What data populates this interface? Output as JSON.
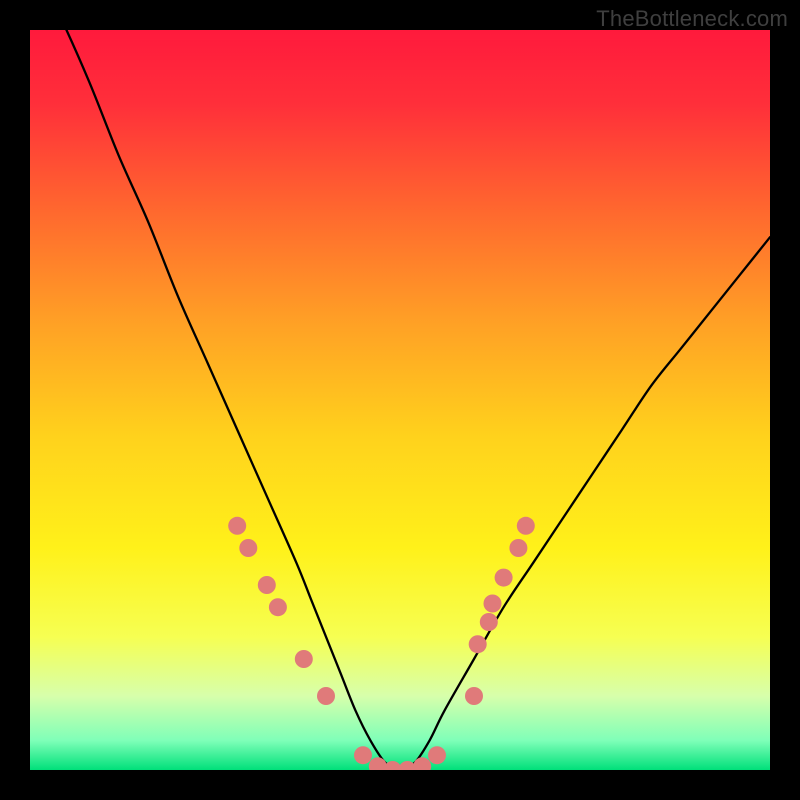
{
  "watermark": "TheBottleneck.com",
  "chart_data": {
    "type": "line",
    "title": "",
    "xlabel": "",
    "ylabel": "",
    "xlim": [
      0,
      100
    ],
    "ylim": [
      0,
      100
    ],
    "gradient_stops": [
      {
        "offset": 0.0,
        "color": "#ff1a3c"
      },
      {
        "offset": 0.1,
        "color": "#ff2f3a"
      },
      {
        "offset": 0.25,
        "color": "#ff6a2e"
      },
      {
        "offset": 0.4,
        "color": "#ffa225"
      },
      {
        "offset": 0.55,
        "color": "#ffd21c"
      },
      {
        "offset": 0.7,
        "color": "#fff11a"
      },
      {
        "offset": 0.82,
        "color": "#f6ff52"
      },
      {
        "offset": 0.9,
        "color": "#d7ffab"
      },
      {
        "offset": 0.96,
        "color": "#7fffb8"
      },
      {
        "offset": 1.0,
        "color": "#00e07a"
      }
    ],
    "series": [
      {
        "name": "bottleneck-curve",
        "x": [
          0,
          4,
          8,
          12,
          16,
          20,
          24,
          28,
          32,
          36,
          38,
          40,
          42,
          44,
          46,
          48,
          50,
          52,
          54,
          56,
          60,
          64,
          68,
          72,
          76,
          80,
          84,
          88,
          92,
          96,
          100
        ],
        "y": [
          110,
          102,
          93,
          83,
          74,
          64,
          55,
          46,
          37,
          28,
          23,
          18,
          13,
          8,
          4,
          1,
          0,
          1,
          4,
          8,
          15,
          22,
          28,
          34,
          40,
          46,
          52,
          57,
          62,
          67,
          72
        ]
      }
    ],
    "markers": {
      "name": "highlight-dots",
      "color": "#e07a7a",
      "radius": 9,
      "points": [
        {
          "x": 28,
          "y": 33
        },
        {
          "x": 29.5,
          "y": 30
        },
        {
          "x": 32,
          "y": 25
        },
        {
          "x": 33.5,
          "y": 22
        },
        {
          "x": 37,
          "y": 15
        },
        {
          "x": 40,
          "y": 10
        },
        {
          "x": 45,
          "y": 2
        },
        {
          "x": 47,
          "y": 0.5
        },
        {
          "x": 49,
          "y": 0
        },
        {
          "x": 51,
          "y": 0
        },
        {
          "x": 53,
          "y": 0.5
        },
        {
          "x": 55,
          "y": 2
        },
        {
          "x": 60,
          "y": 10
        },
        {
          "x": 60.5,
          "y": 17
        },
        {
          "x": 62,
          "y": 20
        },
        {
          "x": 62.5,
          "y": 22.5
        },
        {
          "x": 64,
          "y": 26
        },
        {
          "x": 66,
          "y": 30
        },
        {
          "x": 67,
          "y": 33
        }
      ]
    }
  }
}
